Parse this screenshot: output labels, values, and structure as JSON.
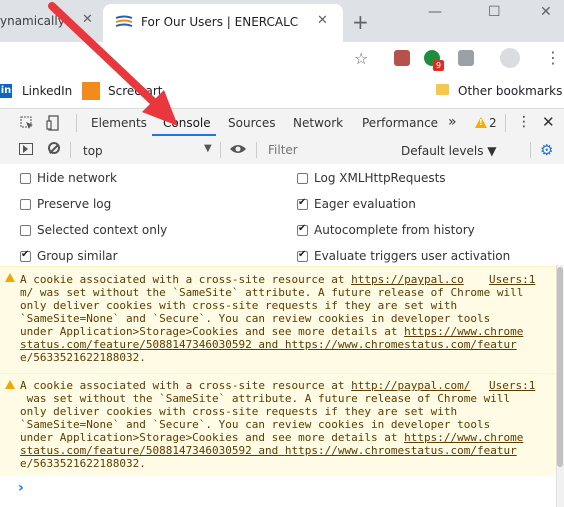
{
  "browser": {
    "tabs": [
      {
        "title": "ynamically",
        "active": false
      },
      {
        "title": "For Our Users | ENERCALC",
        "active": true
      }
    ],
    "new_tab": "+",
    "window_controls": {
      "minimize": "—",
      "maximize": "☐",
      "close": "✕"
    },
    "extensions": {
      "badge_count": "9"
    },
    "bookmarks": [
      {
        "label": "LinkedIn"
      },
      {
        "label": "Scree     art"
      }
    ],
    "other_bookmarks": "Other bookmarks"
  },
  "devtools": {
    "tabs": [
      "Elements",
      "Console",
      "Sources",
      "Network",
      "Performance"
    ],
    "active_tab": "Console",
    "more": "»",
    "warning_count": "2",
    "console_toolbar": {
      "context": "top",
      "filter_placeholder": "Filter",
      "levels": "Default levels ▼"
    },
    "settings": {
      "left": [
        {
          "label": "Hide network",
          "checked": false
        },
        {
          "label": "Preserve log",
          "checked": false
        },
        {
          "label": "Selected context only",
          "checked": false
        },
        {
          "label": "Group similar",
          "checked": true
        }
      ],
      "right": [
        {
          "label": "Log XMLHttpRequests",
          "checked": false
        },
        {
          "label": "Eager evaluation",
          "checked": true
        },
        {
          "label": "Autocomplete from history",
          "checked": true
        },
        {
          "label": "Evaluate triggers user activation",
          "checked": true
        }
      ]
    },
    "messages": [
      {
        "lines": [
          "A cookie associated with a cross-site resource at ",
          "m/ was set without the `SameSite` attribute. A future release of Chrome will",
          "only deliver cookies with cross-site requests if they are set with",
          "`SameSite=None` and `Secure`. You can review cookies in developer tools",
          "under Application>Storage>Cookies and see more details at ",
          "status.com/feature/5088147346030592 and ",
          "e/5633521622188032."
        ],
        "url1": "https://paypal.co",
        "source": "Users:1",
        "url2": "https://www.chrome",
        "url3": "https://www.chromestatus.com/featur"
      },
      {
        "lines": [
          "A cookie associated with a cross-site resource at ",
          " was set without the `SameSite` attribute. A future release of Chrome will",
          "only deliver cookies with cross-site requests if they are set with",
          "`SameSite=None` and `Secure`. You can review cookies in developer tools",
          "under Application>Storage>Cookies and see more details at ",
          "status.com/feature/5088147346030592 and ",
          "e/5633521622188032."
        ],
        "url1": "http://paypal.com/",
        "source": "Users:1",
        "url2": "https://www.chrome",
        "url3": "https://www.chromestatus.com/featur"
      }
    ],
    "prompt": "›"
  }
}
